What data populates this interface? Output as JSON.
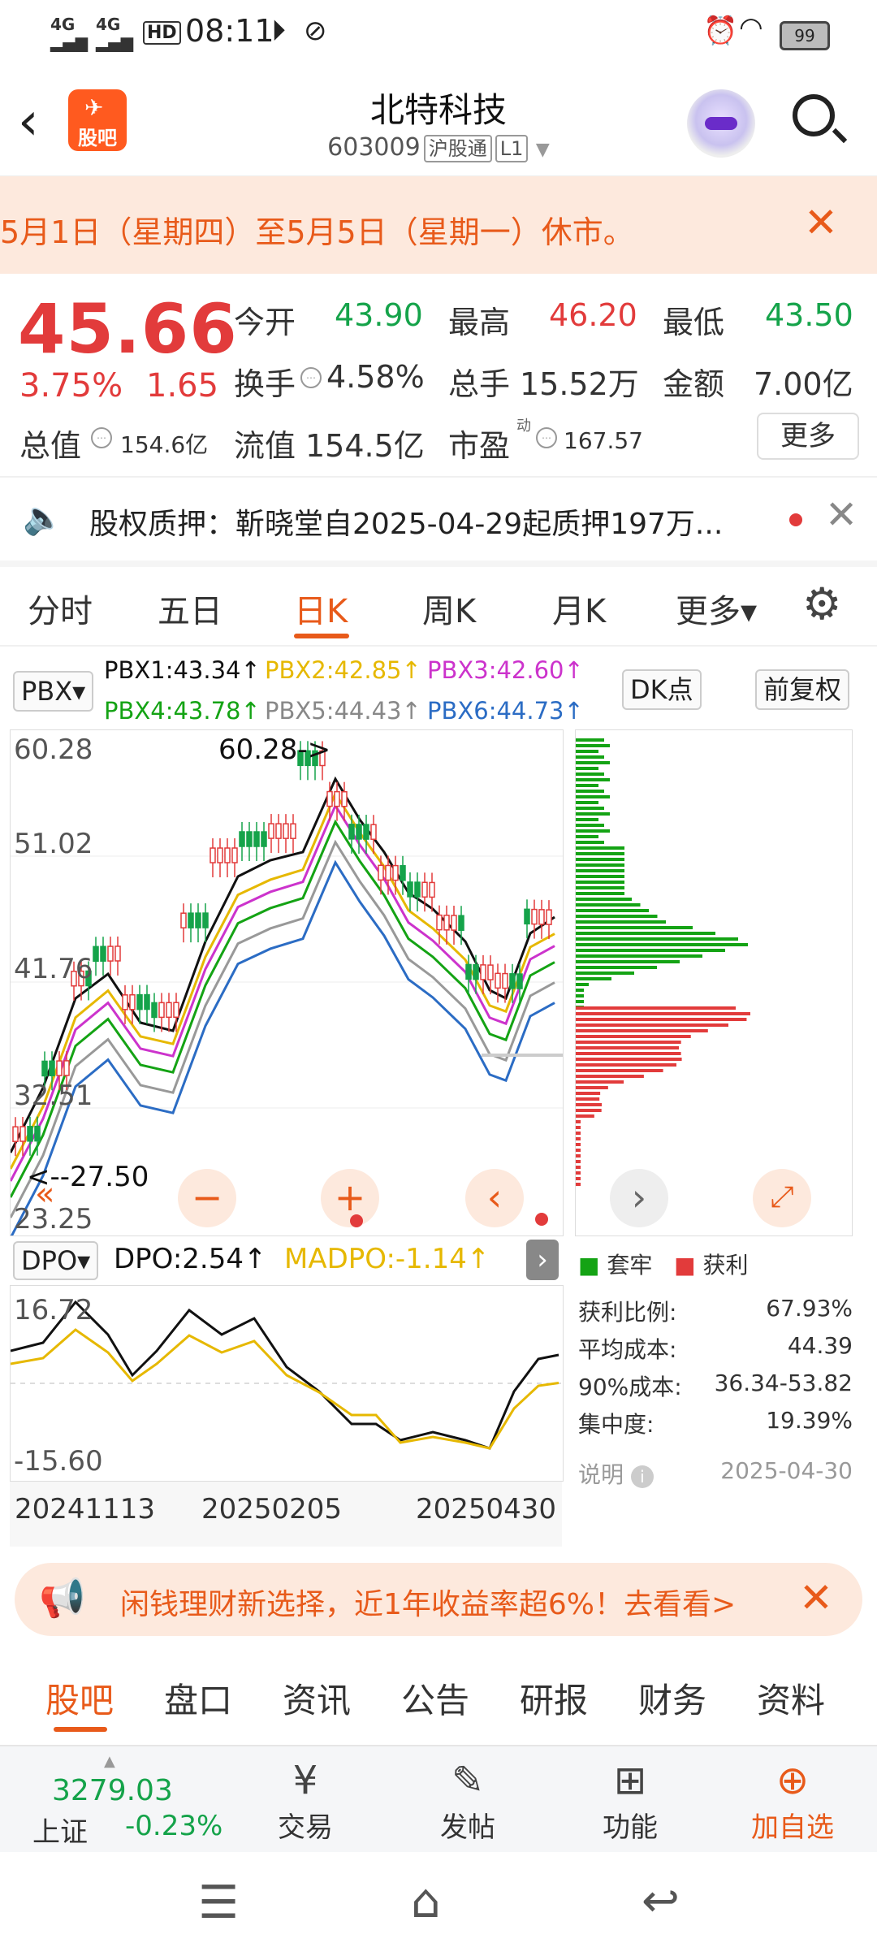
{
  "status_bar": {
    "sig1": "4G",
    "sig2": "4G",
    "hd": "HD",
    "time": "08:11",
    "battery": "99"
  },
  "header": {
    "logo": "股吧",
    "title": "北特科技",
    "code": "603009",
    "tag1": "沪股通",
    "tag2": "L1"
  },
  "notice": {
    "text": "5月1日（星期四）至5月5日（星期一）休市。",
    "close": "✕"
  },
  "quote": {
    "price": "45.66",
    "change_pct": "3.75%",
    "change": "1.65",
    "open_label": "今开",
    "open": "43.90",
    "high_label": "最高",
    "high": "46.20",
    "low_label": "最低",
    "low": "43.50",
    "turnover_label": "换手",
    "turnover": "4.58%",
    "vol_label": "总手",
    "vol": "15.52万",
    "amount_label": "金额",
    "amount": "7.00亿",
    "mktcap_label": "总值",
    "mktcap": "154.6亿",
    "float_label": "流值",
    "float": "154.5亿",
    "pe_label": "市盈",
    "pe_sup": "动",
    "pe": "167.57",
    "more": "更多"
  },
  "pledge": {
    "text": "股权质押：靳晓堂自2025-04-29起质押197万...",
    "close": "✕"
  },
  "ktabs": [
    "分时",
    "五日",
    "日K",
    "周K",
    "月K",
    "更多▾"
  ],
  "indicator": {
    "select": "PBX▾",
    "pbx1": "PBX1:43.34↑",
    "pbx2": "PBX2:42.85↑",
    "pbx3": "PBX3:42.60↑",
    "pbx4": "PBX4:43.78↑",
    "pbx5": "PBX5:44.43↑",
    "pbx6": "PBX6:44.73↑",
    "dk": "DK点",
    "fq": "前复权"
  },
  "chart": {
    "y_top": "60.28",
    "y_2": "51.02",
    "y_3": "41.76",
    "y_4": "32.51",
    "y_bottom": "23.25",
    "max_note": "60.28->",
    "min_note": "<--27.50",
    "x_labels": [
      "20241113",
      "20250205",
      "20250430"
    ],
    "colors": {
      "pbx1": "#111111",
      "pbx2": "#e6b800",
      "pbx3": "#cc33cc",
      "pbx4": "#14a314",
      "pbx5": "#999999",
      "pbx6": "#2b6cc4",
      "up": "#e23b3b",
      "down": "#15a34a"
    }
  },
  "dpo": {
    "select": "DPO▾",
    "dpo": "DPO:2.54↑",
    "madpo": "MADPO:-1.14↑",
    "y_top": "16.72",
    "y_bottom": "-15.60"
  },
  "chips": {
    "legend_trap": "套牢",
    "legend_profit": "获利",
    "rows": [
      {
        "label": "获利比例:",
        "value": "67.93%"
      },
      {
        "label": "平均成本:",
        "value": "44.39"
      },
      {
        "label": "90%成本:",
        "value": "36.34-53.82"
      },
      {
        "label": "集中度:",
        "value": "19.39%"
      }
    ],
    "note_label": "说明",
    "date": "2025-04-30"
  },
  "ad": {
    "text": "闲钱理财新选择，近1年收益率超6%！去看看>",
    "close": "✕"
  },
  "section_tabs": [
    "股吧",
    "盘口",
    "资讯",
    "公告",
    "研报",
    "财务",
    "资料"
  ],
  "bottom": {
    "index_value": "3279.03",
    "index_name": "上证",
    "index_change": "-0.23%",
    "trade": "交易",
    "post": "发帖",
    "func": "功能",
    "add": "加自选"
  }
}
